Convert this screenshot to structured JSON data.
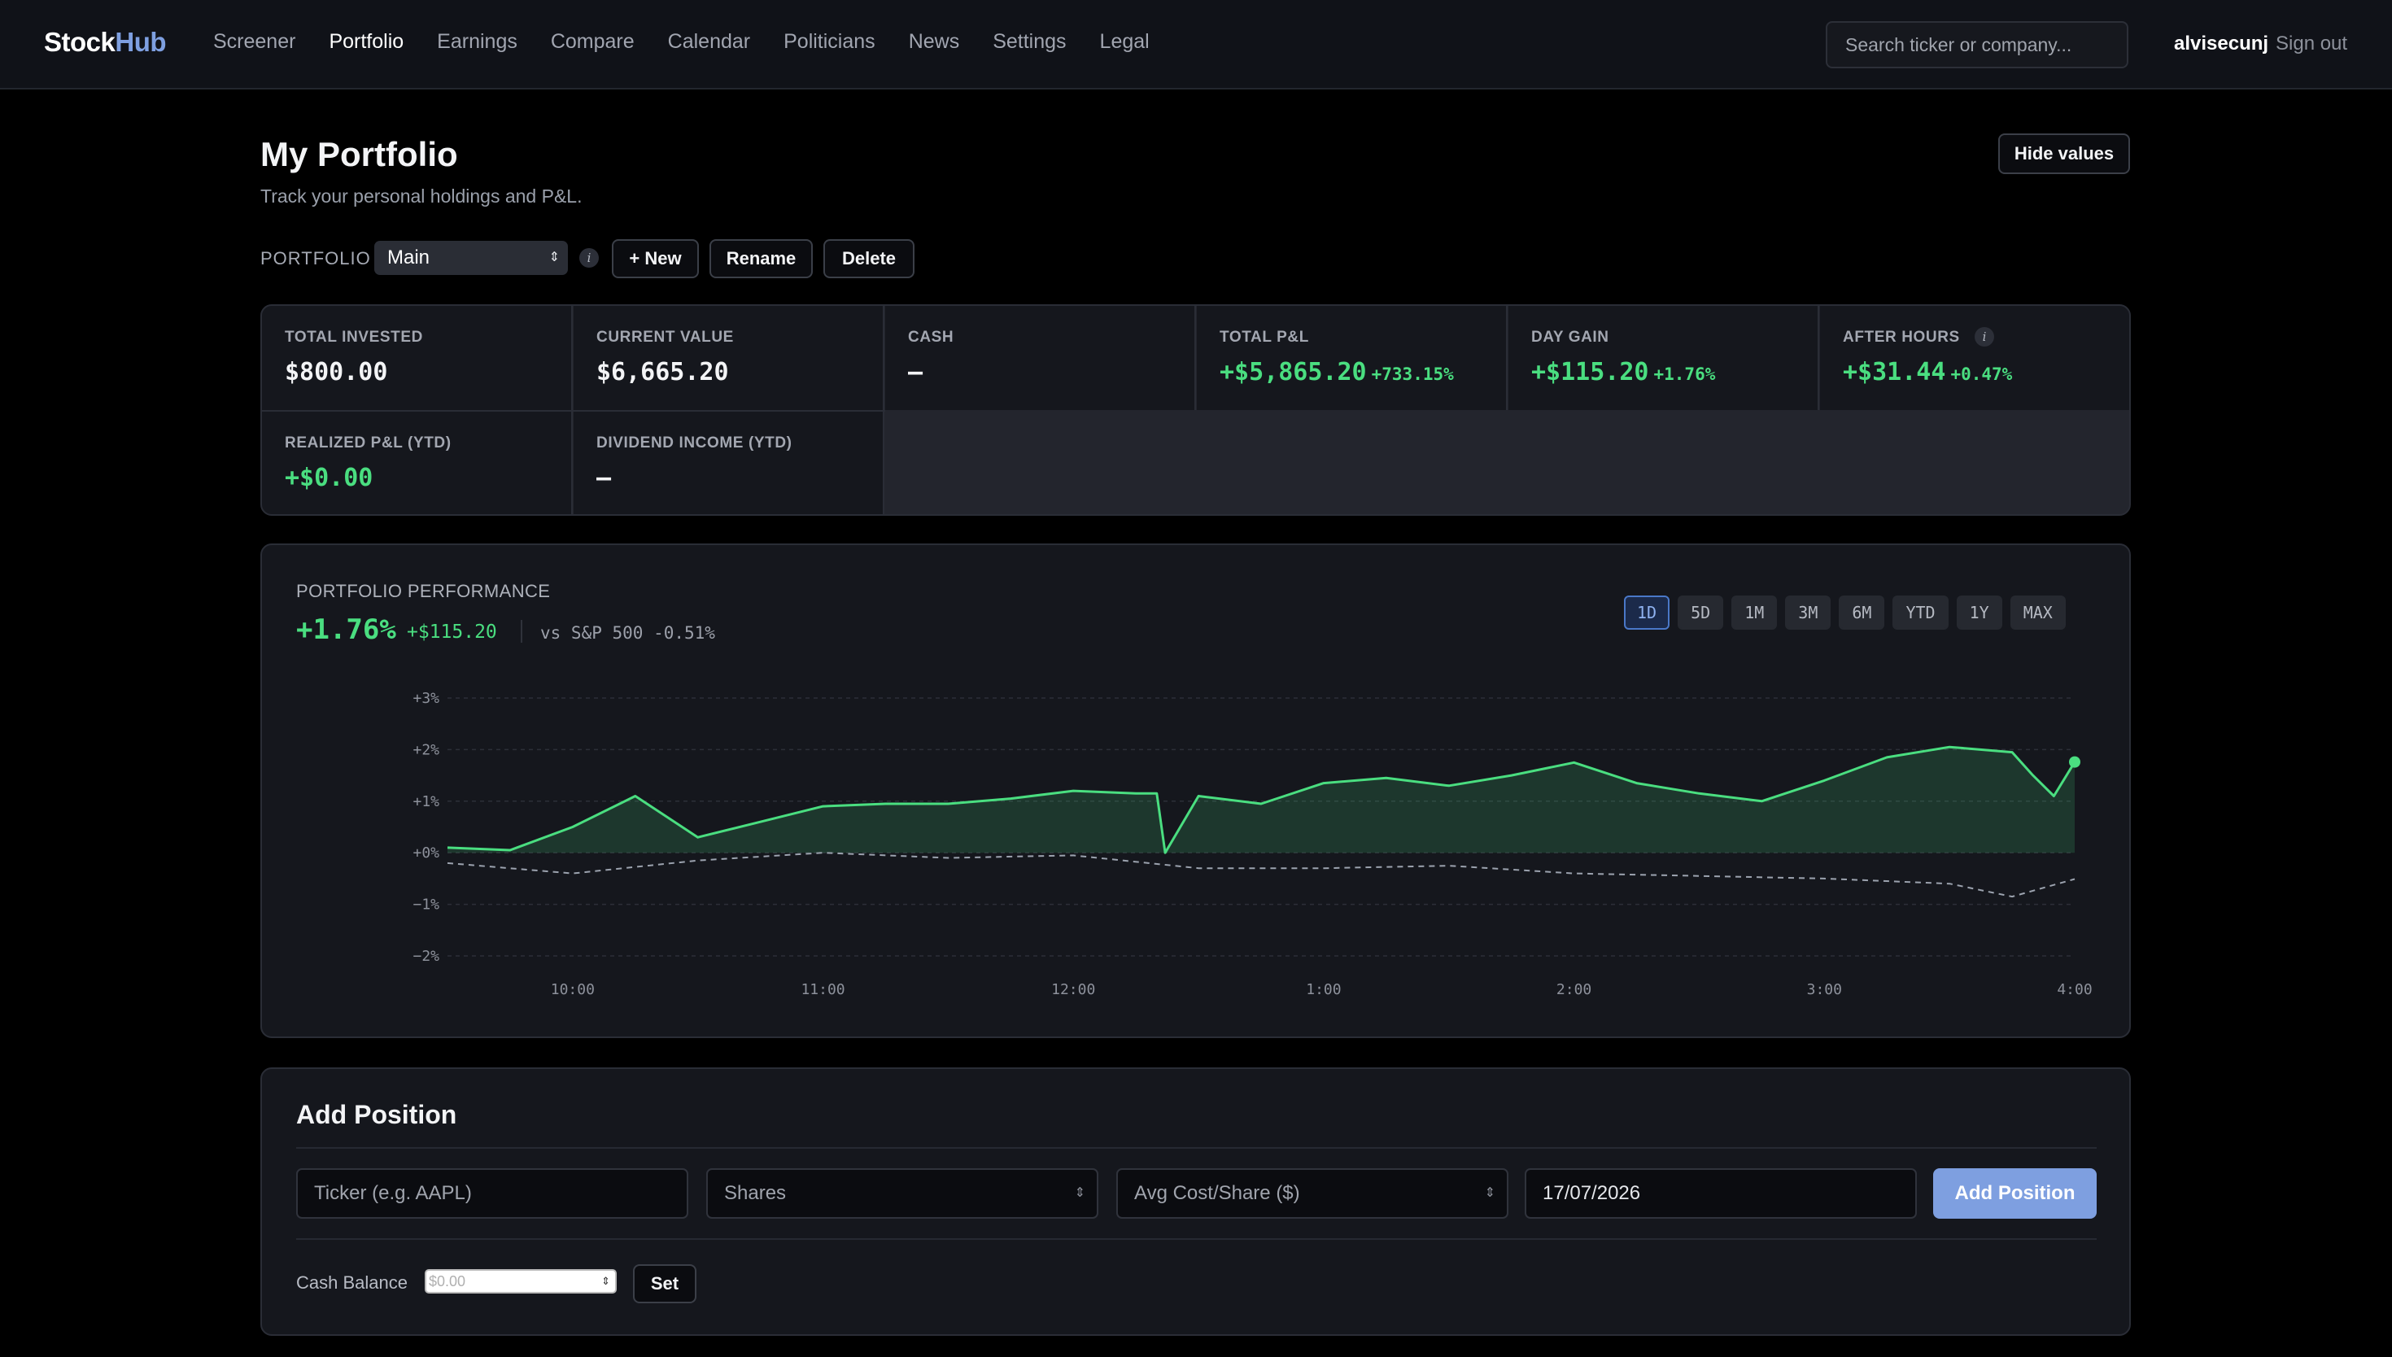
{
  "nav": {
    "logo_a": "Stock",
    "logo_b": "Hub",
    "links": [
      "Screener",
      "Portfolio",
      "Earnings",
      "Compare",
      "Calendar",
      "Politicians",
      "News",
      "Settings",
      "Legal"
    ],
    "active": "Portfolio",
    "search_placeholder": "Search ticker or company...",
    "username": "alvisecunj",
    "signout": "Sign out"
  },
  "header": {
    "title": "My Portfolio",
    "subtitle": "Track your personal holdings and P&L.",
    "hide_values": "Hide values"
  },
  "portfolio_bar": {
    "label": "PORTFOLIO",
    "selected": "Main",
    "info": "i",
    "new": "+ New",
    "rename": "Rename",
    "delete": "Delete"
  },
  "stats": {
    "total_invested": {
      "label": "TOTAL INVESTED",
      "value": "$800.00"
    },
    "current_value": {
      "label": "CURRENT VALUE",
      "value": "$6,665.20"
    },
    "cash": {
      "label": "CASH",
      "value": "—"
    },
    "total_pl": {
      "label": "TOTAL P&L",
      "value": "+$5,865.20",
      "pct": "+733.15%"
    },
    "day_gain": {
      "label": "DAY GAIN",
      "value": "+$115.20",
      "pct": "+1.76%"
    },
    "after_hours": {
      "label": "AFTER HOURS",
      "value": "+$31.44",
      "pct": "+0.47%"
    },
    "realized_pl": {
      "label": "REALIZED P&L (YTD)",
      "value": "+$0.00"
    },
    "dividend_income": {
      "label": "DIVIDEND INCOME (YTD)",
      "value": "—"
    }
  },
  "performance": {
    "title": "PORTFOLIO PERFORMANCE",
    "change": "+1.76%",
    "gain": "+$115.20",
    "vs": "vs S&P 500 -0.51%",
    "ranges": [
      "1D",
      "5D",
      "1M",
      "3M",
      "6M",
      "YTD",
      "1Y",
      "MAX"
    ],
    "active_range": "1D"
  },
  "chart_data": {
    "type": "area",
    "y_tick_labels": [
      "+3%",
      "+2%",
      "+1%",
      "+0%",
      "-1%",
      "-2%"
    ],
    "x_tick_labels": [
      "10:00",
      "11:00",
      "12:00",
      "1:00",
      "2:00",
      "3:00",
      "4:00"
    ],
    "ylim": [
      -2,
      3
    ],
    "grid": true,
    "colors": {
      "portfolio": "#4ade80",
      "benchmark": "#9ca3af"
    },
    "series": [
      {
        "x": [
          "9:30",
          "9:45",
          "10:00",
          "10:15",
          "10:30",
          "10:45",
          "11:00",
          "11:15",
          "11:30",
          "11:45",
          "12:00",
          "12:15",
          "12:20",
          "12:22",
          "12:30",
          "12:45",
          "1:00",
          "1:15",
          "1:30",
          "1:45",
          "2:00",
          "2:15",
          "2:30",
          "2:45",
          "3:00",
          "3:15",
          "3:30",
          "3:45",
          "3:50",
          "3:55",
          "4:00"
        ],
        "values": [
          0.1,
          0.05,
          0.5,
          1.1,
          0.3,
          0.6,
          0.9,
          0.95,
          0.95,
          1.05,
          1.2,
          1.15,
          1.15,
          0.0,
          1.1,
          0.95,
          1.35,
          1.45,
          1.3,
          1.5,
          1.75,
          1.35,
          1.15,
          1.0,
          1.4,
          1.85,
          2.05,
          1.95,
          1.5,
          1.1,
          1.76
        ]
      },
      {
        "x": [
          "9:30",
          "10:00",
          "10:30",
          "11:00",
          "11:30",
          "12:00",
          "12:30",
          "1:00",
          "1:30",
          "2:00",
          "2:30",
          "3:00",
          "3:30",
          "3:45",
          "4:00"
        ],
        "values": [
          -0.2,
          -0.4,
          -0.15,
          0.0,
          -0.1,
          -0.05,
          -0.3,
          -0.3,
          -0.25,
          -0.4,
          -0.45,
          -0.5,
          -0.6,
          -0.85,
          -0.51
        ]
      }
    ]
  },
  "add_position": {
    "title": "Add Position",
    "ticker_placeholder": "Ticker (e.g. AAPL)",
    "shares_placeholder": "Shares",
    "avg_cost_placeholder": "Avg Cost/Share ($)",
    "date_value": "17/07/2026",
    "submit": "Add Position",
    "cash_label": "Cash Balance",
    "cash_placeholder": "$0.00",
    "set": "Set"
  }
}
